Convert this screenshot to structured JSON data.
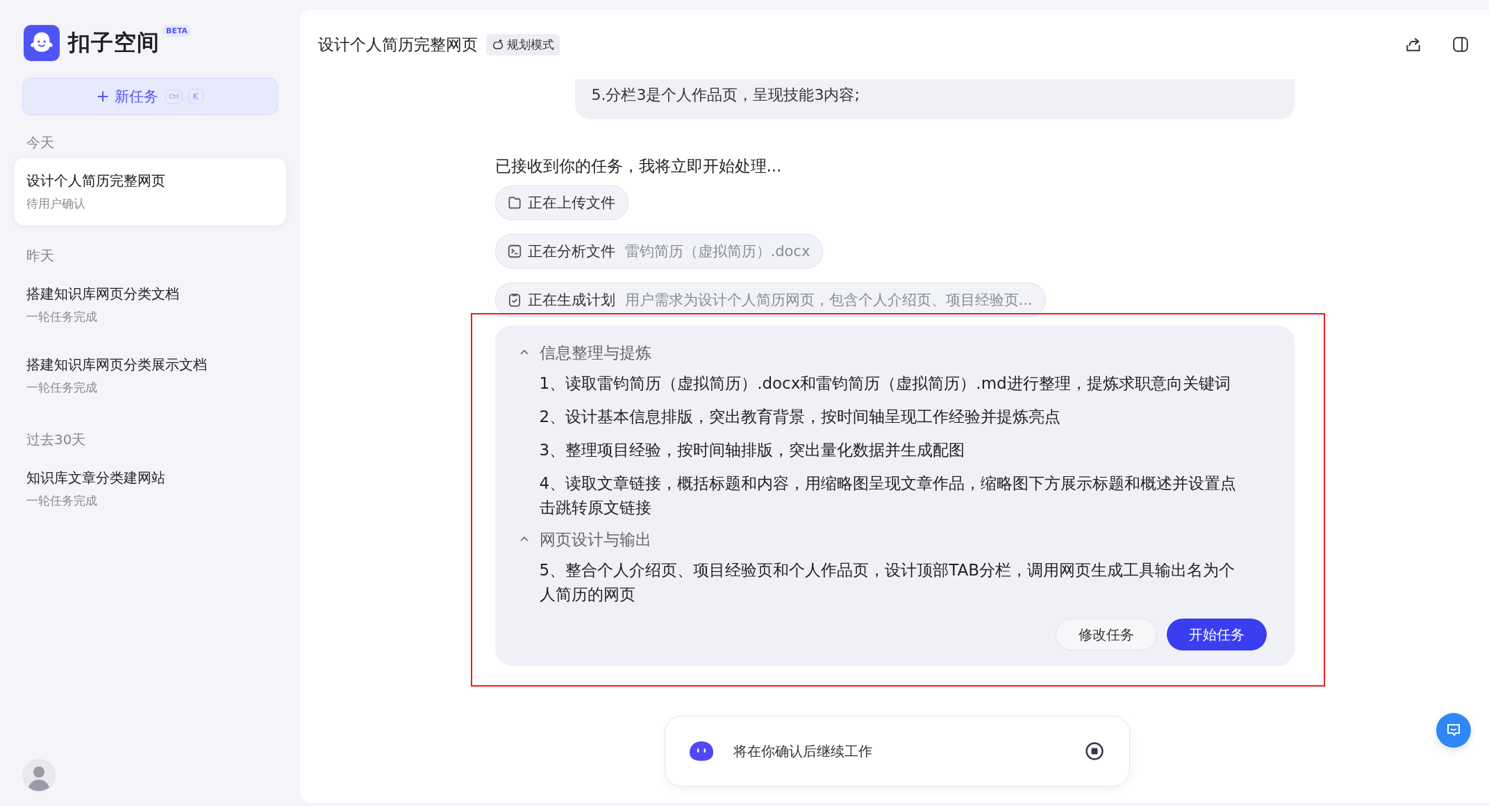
{
  "app": {
    "name": "扣子空间",
    "badge": "BETA"
  },
  "new_task": {
    "label": "新任务",
    "shortcut": [
      "Ctrl",
      "K"
    ]
  },
  "sidebar": {
    "groups": [
      {
        "label": "今天",
        "items": [
          {
            "title": "设计个人简历完整网页",
            "status": "待用户确认",
            "selected": true
          }
        ]
      },
      {
        "label": "昨天",
        "items": [
          {
            "title": "搭建知识库网页分类文档",
            "status": "一轮任务完成",
            "selected": false
          },
          {
            "title": "搭建知识库网页分类展示文档",
            "status": "一轮任务完成",
            "selected": false
          }
        ]
      },
      {
        "label": "过去30天",
        "items": [
          {
            "title": "知识库文章分类建网站",
            "status": "一轮任务完成",
            "selected": false
          }
        ]
      }
    ]
  },
  "header": {
    "title": "设计个人简历完整网页",
    "mode": "规划模式"
  },
  "conversation": {
    "user_message": "5.分栏3是个人作品页，呈现技能3内容;",
    "reply": "已接收到你的任务，我将立即开始处理...",
    "steps": [
      {
        "kind": "upload",
        "label": "正在上传文件"
      },
      {
        "kind": "analyze",
        "label": "正在分析文件",
        "detail": "雷钧简历（虚拟简历）.docx"
      },
      {
        "kind": "plan",
        "label": "正在生成计划",
        "detail": "用户需求为设计个人简历网页，包含个人介绍页、项目经验页..."
      }
    ]
  },
  "plan": {
    "highlighted": true,
    "sections": [
      {
        "title": "信息整理与提炼",
        "expanded": true,
        "items": [
          "1、读取雷钧简历（虚拟简历）.docx和雷钧简历（虚拟简历）.md进行整理，提炼求职意向关键词",
          "2、设计基本信息排版，突出教育背景，按时间轴呈现工作经验并提炼亮点",
          "3、整理项目经验，按时间轴排版，突出量化数据并生成配图",
          "4、读取文章链接，概括标题和内容，用缩略图呈现文章作品，缩略图下方展示标题和概述并设置点击跳转原文链接"
        ]
      },
      {
        "title": "网页设计与输出",
        "expanded": true,
        "items": [
          "5、整合个人介绍页、项目经验页和个人作品页，设计顶部TAB分栏，调用网页生成工具输出名为个人简历的网页"
        ]
      }
    ],
    "buttons": [
      {
        "kind": "secondary",
        "label": "修改任务"
      },
      {
        "kind": "primary",
        "label": "开始任务"
      }
    ]
  },
  "input": {
    "status": "将在你确认后继续工作"
  }
}
